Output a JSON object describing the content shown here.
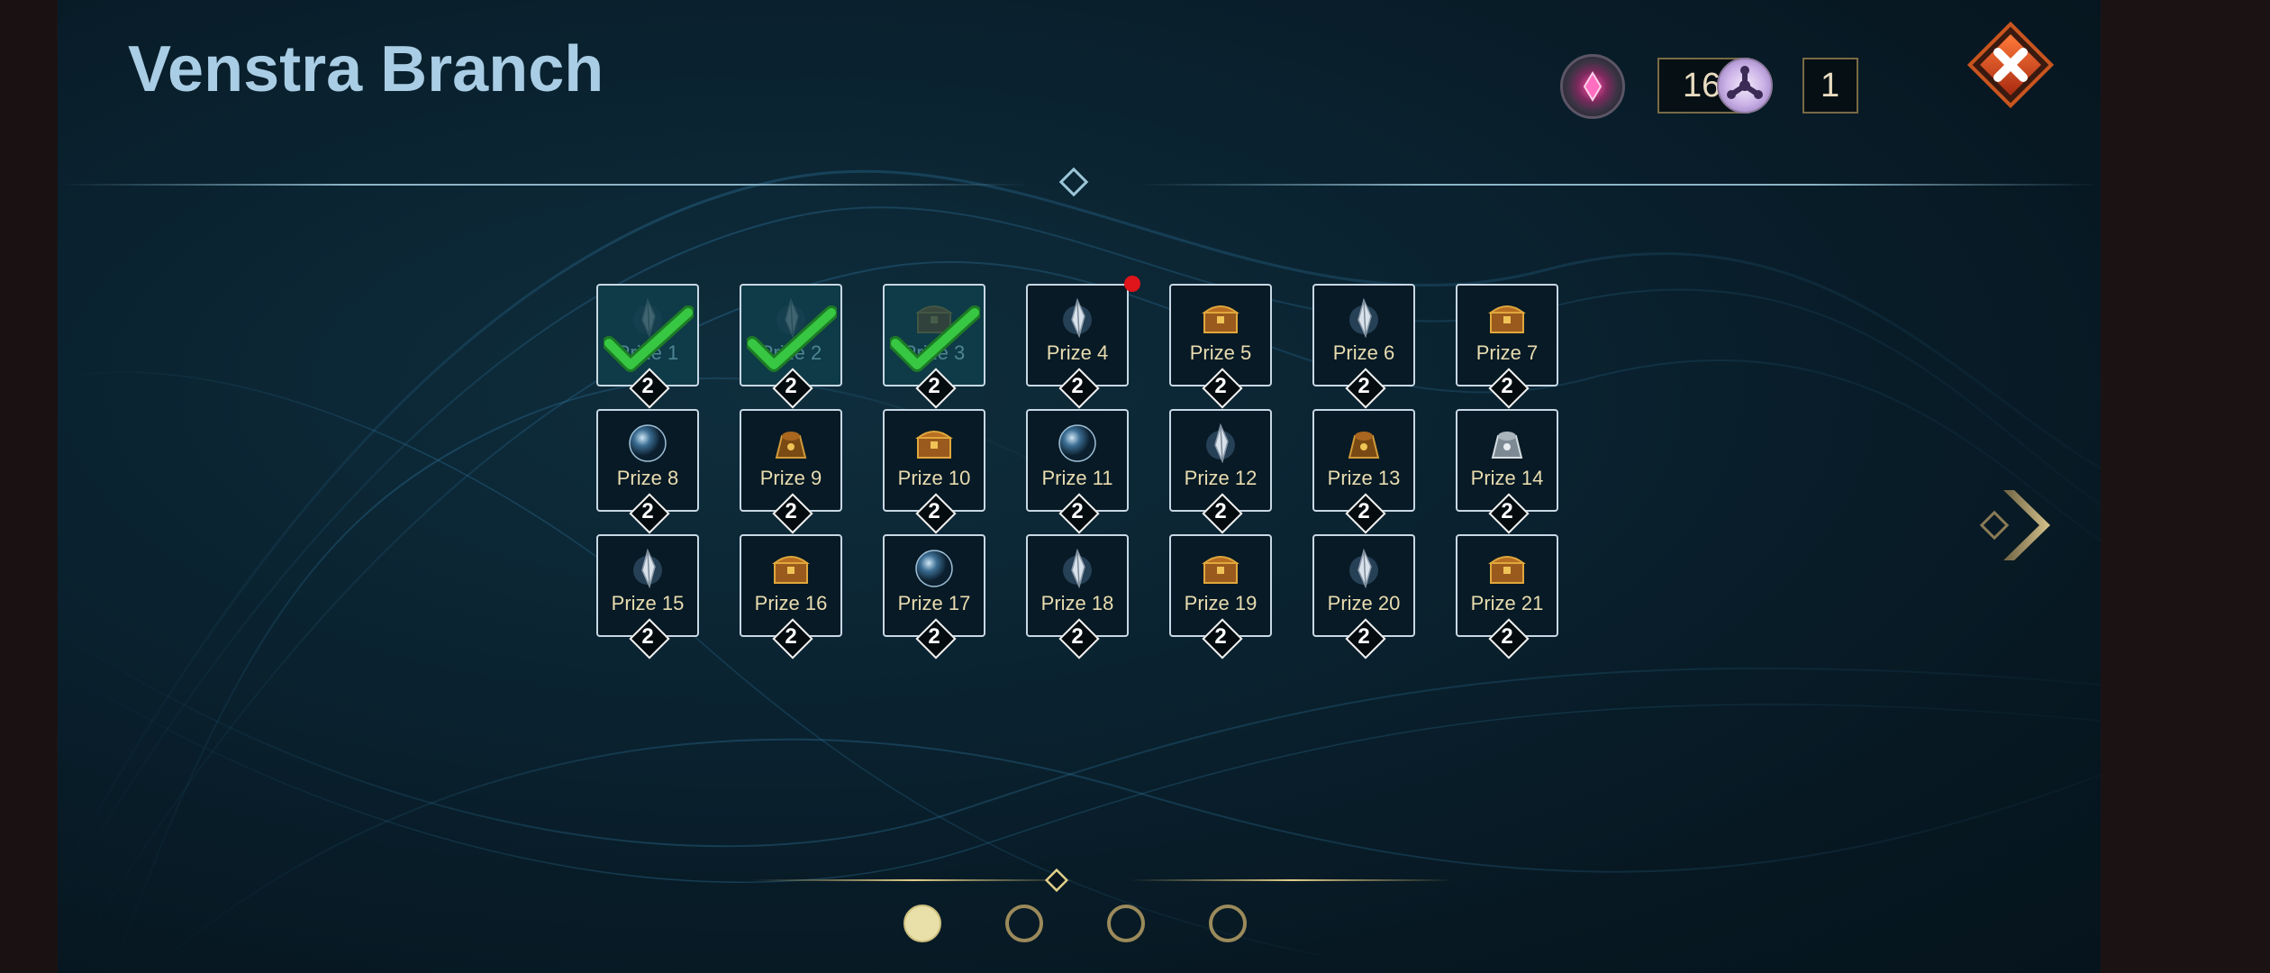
{
  "title": "Venstra Branch",
  "currencies": [
    {
      "icon": "gem-orb-icon",
      "value": "160"
    },
    {
      "icon": "triskelion-token-icon",
      "value": "1"
    }
  ],
  "close_icon": "close-icon",
  "prizes": [
    {
      "label": "Prize 1",
      "count": "2",
      "icon": "crystal-icon",
      "claimed": true
    },
    {
      "label": "Prize 2",
      "count": "2",
      "icon": "crystal-icon",
      "claimed": true
    },
    {
      "label": "Prize 3",
      "count": "2",
      "icon": "chest-icon",
      "claimed": true
    },
    {
      "label": "Prize 4",
      "count": "2",
      "icon": "crystal-icon",
      "claimed": false,
      "notify": true
    },
    {
      "label": "Prize 5",
      "count": "2",
      "icon": "chest-icon",
      "claimed": false
    },
    {
      "label": "Prize 6",
      "count": "2",
      "icon": "crystal-icon",
      "claimed": false
    },
    {
      "label": "Prize 7",
      "count": "2",
      "icon": "chest-icon",
      "claimed": false
    },
    {
      "label": "Prize 8",
      "count": "2",
      "icon": "orb-icon",
      "claimed": false
    },
    {
      "label": "Prize 9",
      "count": "2",
      "icon": "bag-icon",
      "claimed": false
    },
    {
      "label": "Prize 10",
      "count": "2",
      "icon": "chest-icon",
      "claimed": false
    },
    {
      "label": "Prize 11",
      "count": "2",
      "icon": "orb-icon",
      "claimed": false
    },
    {
      "label": "Prize 12",
      "count": "2",
      "icon": "crystal-icon",
      "claimed": false
    },
    {
      "label": "Prize 13",
      "count": "2",
      "icon": "bag-icon",
      "claimed": false
    },
    {
      "label": "Prize 14",
      "count": "2",
      "icon": "silver-bag-icon",
      "claimed": false
    },
    {
      "label": "Prize 15",
      "count": "2",
      "icon": "crystal-icon",
      "claimed": false
    },
    {
      "label": "Prize 16",
      "count": "2",
      "icon": "chest-icon",
      "claimed": false
    },
    {
      "label": "Prize 17",
      "count": "2",
      "icon": "orb-icon",
      "claimed": false
    },
    {
      "label": "Prize 18",
      "count": "2",
      "icon": "crystal-icon",
      "claimed": false
    },
    {
      "label": "Prize 19",
      "count": "2",
      "icon": "chest-icon",
      "claimed": false
    },
    {
      "label": "Prize 20",
      "count": "2",
      "icon": "crystal-icon",
      "claimed": false
    },
    {
      "label": "Prize 21",
      "count": "2",
      "icon": "chest-icon",
      "claimed": false
    }
  ],
  "pagination": {
    "pages": 4,
    "current": 1
  },
  "colors": {
    "accent_gold": "#c9b26a",
    "tile_border": "#c8d8e4",
    "claimed_check": "#2fbf3a",
    "notify_dot": "#e0141b"
  }
}
